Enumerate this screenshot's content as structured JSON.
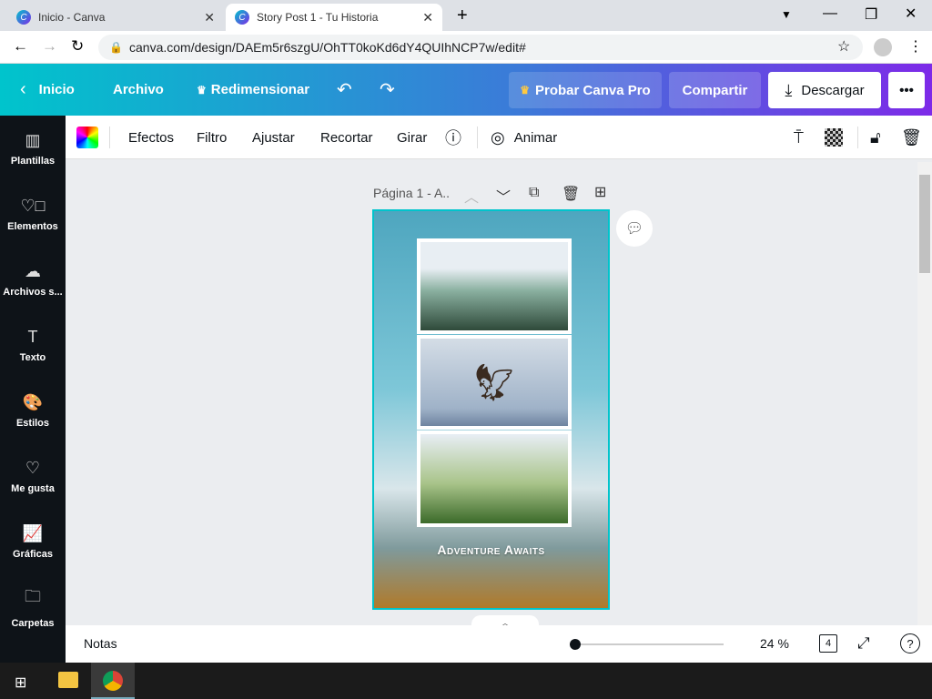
{
  "browser": {
    "tabs": [
      {
        "title": "Inicio - Canva"
      },
      {
        "title": "Story Post 1 - Tu Historia"
      }
    ],
    "url": "canva.com/design/DAEm5r6szgU/OhTT0koKd6dY4QUIhNCP7w/edit#"
  },
  "topbar": {
    "home": "Inicio",
    "file": "Archivo",
    "resize": "Redimensionar",
    "try_pro": "Probar Canva Pro",
    "share": "Compartir",
    "download": "Descargar",
    "more": "•••"
  },
  "toolbar": {
    "items": [
      "Efectos",
      "Filtro",
      "Ajustar",
      "Recortar",
      "Girar"
    ],
    "animate": "Animar"
  },
  "sidebar": {
    "items": [
      {
        "label": "Plantillas",
        "icon": "▥"
      },
      {
        "label": "Elementos",
        "icon": "♡□"
      },
      {
        "label": "Archivos s...",
        "icon": "☁"
      },
      {
        "label": "Texto",
        "icon": "T"
      },
      {
        "label": "Estilos",
        "icon": "🎨"
      },
      {
        "label": "Me gusta",
        "icon": "♡"
      },
      {
        "label": "Gráficas",
        "icon": "📈"
      },
      {
        "label": "Carpetas",
        "icon": "🗀"
      }
    ]
  },
  "page": {
    "label": "Página 1 - A..",
    "caption": "Adventure Awaits"
  },
  "bottom": {
    "notes": "Notas",
    "zoom": "24 %",
    "zoom_fraction": 0.0,
    "pages": "4"
  }
}
